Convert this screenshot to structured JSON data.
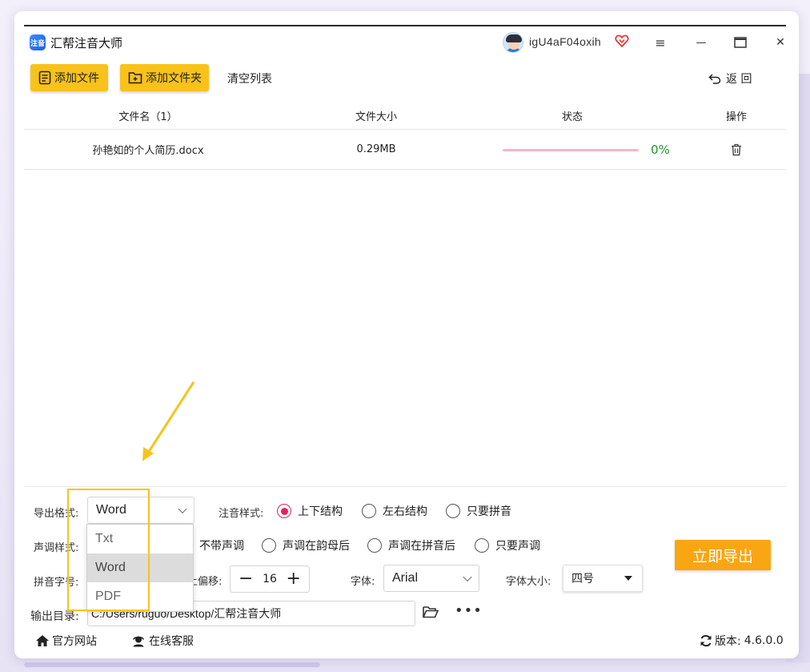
{
  "app": {
    "title": "汇帮注音大师",
    "logo_text": "注音",
    "username": "igU4aF04oxih"
  },
  "window_controls": {
    "menu": "≡",
    "minimize": "—",
    "maximize": "□",
    "close": "✕"
  },
  "toolbar": {
    "add_file": "添加文件",
    "add_folder": "添加文件夹",
    "clear_list": "清空列表",
    "back": "返 回"
  },
  "table": {
    "headers": {
      "filename": "文件名（1）",
      "size": "文件大小",
      "status": "状态",
      "action": "操作"
    },
    "rows": [
      {
        "filename": "孙艳如的个人简历.docx",
        "size": "0.29MB",
        "progress_percent": 0,
        "progress_label": "0%"
      }
    ]
  },
  "settings": {
    "export_format": {
      "label": "导出格式:",
      "value": "Word",
      "options": [
        "Txt",
        "Word",
        "PDF"
      ]
    },
    "annotation_style": {
      "label": "注音样式:",
      "options": [
        "上下结构",
        "左右结构",
        "只要拼音"
      ],
      "selected": "上下结构"
    },
    "tone_style": {
      "label": "声调样式:",
      "options": [
        "不带声调",
        "声调在韵母后",
        "声调在拼音后",
        "只要声调"
      ]
    },
    "pinyin_size": {
      "label": "拼音字号:"
    },
    "offset": {
      "label": "上偏移:",
      "value": "16",
      "minus": "−",
      "plus": "+"
    },
    "font": {
      "label": "字体:",
      "value": "Arial"
    },
    "font_size": {
      "label": "字体大小:",
      "value": "四号"
    },
    "output_dir": {
      "label": "输出目录:",
      "value": "C:/Users/ruguo/Desktop/汇帮注音大师"
    },
    "export_button": "立即导出"
  },
  "footer": {
    "website": "官方网站",
    "support": "在线客服",
    "version_label": "版本:",
    "version": "4.6.0.0"
  },
  "colors": {
    "accent_yellow": "#f8c21a",
    "export_orange": "#f9a612",
    "radio_pink": "#e0245e",
    "progress_pink": "#f5b7c8",
    "percent_green": "#1a9a28"
  }
}
